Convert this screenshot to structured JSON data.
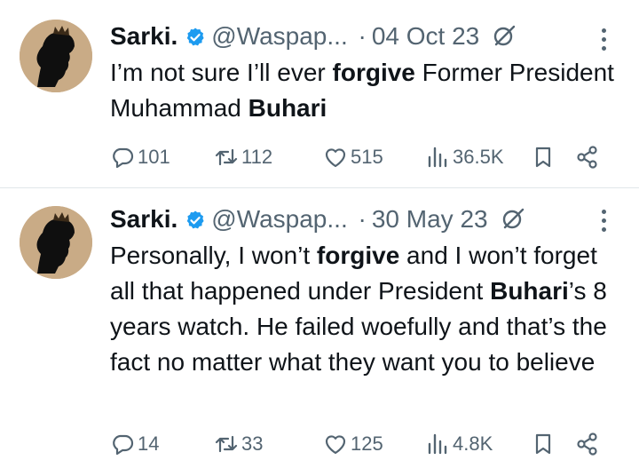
{
  "tweets": [
    {
      "name": "Sarki.",
      "handle": "@Waspap...",
      "separator": "·",
      "date": "04 Oct 23",
      "text_parts": [
        {
          "t": "I’m not sure I’ll ever ",
          "b": false
        },
        {
          "t": "forgive",
          "b": true
        },
        {
          "t": " Former President Muhammad ",
          "b": false
        },
        {
          "t": "Buhari",
          "b": true
        }
      ],
      "replies": "101",
      "reposts": "112",
      "likes": "515",
      "views": "36.5K"
    },
    {
      "name": "Sarki.",
      "handle": "@Waspap...",
      "separator": "·",
      "date": "30 May 23",
      "text_parts": [
        {
          "t": "Personally, I won’t ",
          "b": false
        },
        {
          "t": "forgive",
          "b": true
        },
        {
          "t": " and I won’t forget all that happened under President ",
          "b": false
        },
        {
          "t": "Buhari",
          "b": true
        },
        {
          "t": "’s 8 years watch. He failed woefully and that’s the fact no matter what they want you to believe",
          "b": false
        }
      ],
      "replies": "14",
      "reposts": "33",
      "likes": "125",
      "views": "4.8K"
    }
  ],
  "icons": {
    "verified": "verified-badge-icon",
    "grok": "grok-icon",
    "more": "more-icon",
    "reply": "reply-icon",
    "repost": "repost-icon",
    "like": "like-icon",
    "views": "views-icon",
    "bookmark": "bookmark-icon",
    "share": "share-icon"
  },
  "colors": {
    "text": "#0f1419",
    "secondary": "#536471",
    "verified": "#1d9bf0",
    "avatar_bg": "#c9ab86",
    "divider": "#e1e6ea"
  }
}
